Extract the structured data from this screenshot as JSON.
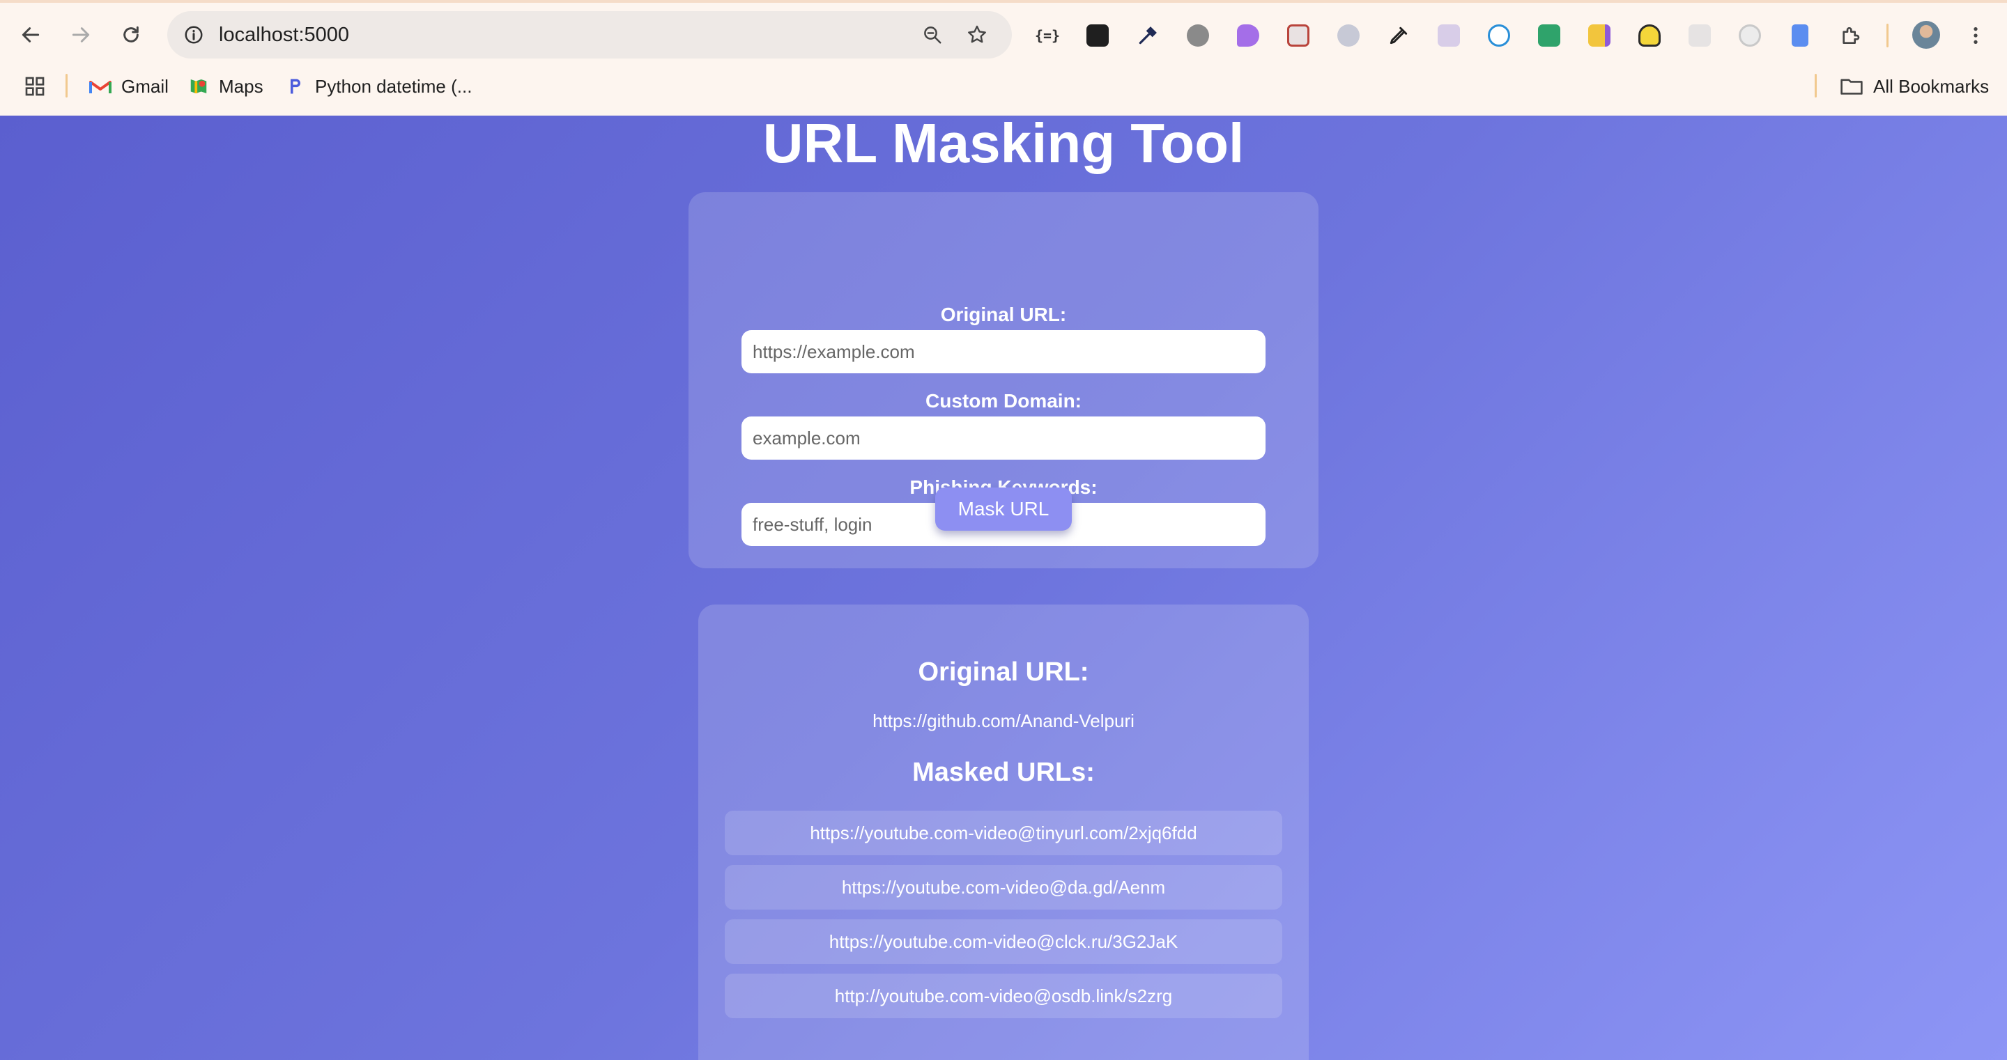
{
  "browser": {
    "url": "localhost:5000",
    "bookmarks": [
      {
        "label": "Gmail",
        "icon": "gmail-icon"
      },
      {
        "label": "Maps",
        "icon": "maps-icon"
      },
      {
        "label": "Python datetime (...",
        "icon": "pycharm-icon"
      }
    ],
    "all_bookmarks_label": "All Bookmarks"
  },
  "page": {
    "title": "URL Masking Tool",
    "form": {
      "original_url_label": "Original URL:",
      "original_url_placeholder": "https://example.com",
      "custom_domain_label": "Custom Domain:",
      "custom_domain_placeholder": "example.com",
      "phishing_keywords_label": "Phishing Keywords:",
      "phishing_keywords_placeholder": "free-stuff, login",
      "submit_label": "Mask URL"
    },
    "result": {
      "original_heading": "Original URL:",
      "original_value": "https://github.com/Anand-Velpuri",
      "masked_heading": "Masked URLs:",
      "masked_urls": [
        "https://youtube.com-video@tinyurl.com/2xjq6fdd",
        "https://youtube.com-video@da.gd/Aenm",
        "https://youtube.com-video@clck.ru/3G2JaK",
        "http://youtube.com-video@osdb.link/s2zrg"
      ]
    }
  },
  "colors": {
    "page_gradient_start": "#5b5fcf",
    "page_gradient_end": "#8d95f5",
    "button": "#8d8ff2"
  }
}
